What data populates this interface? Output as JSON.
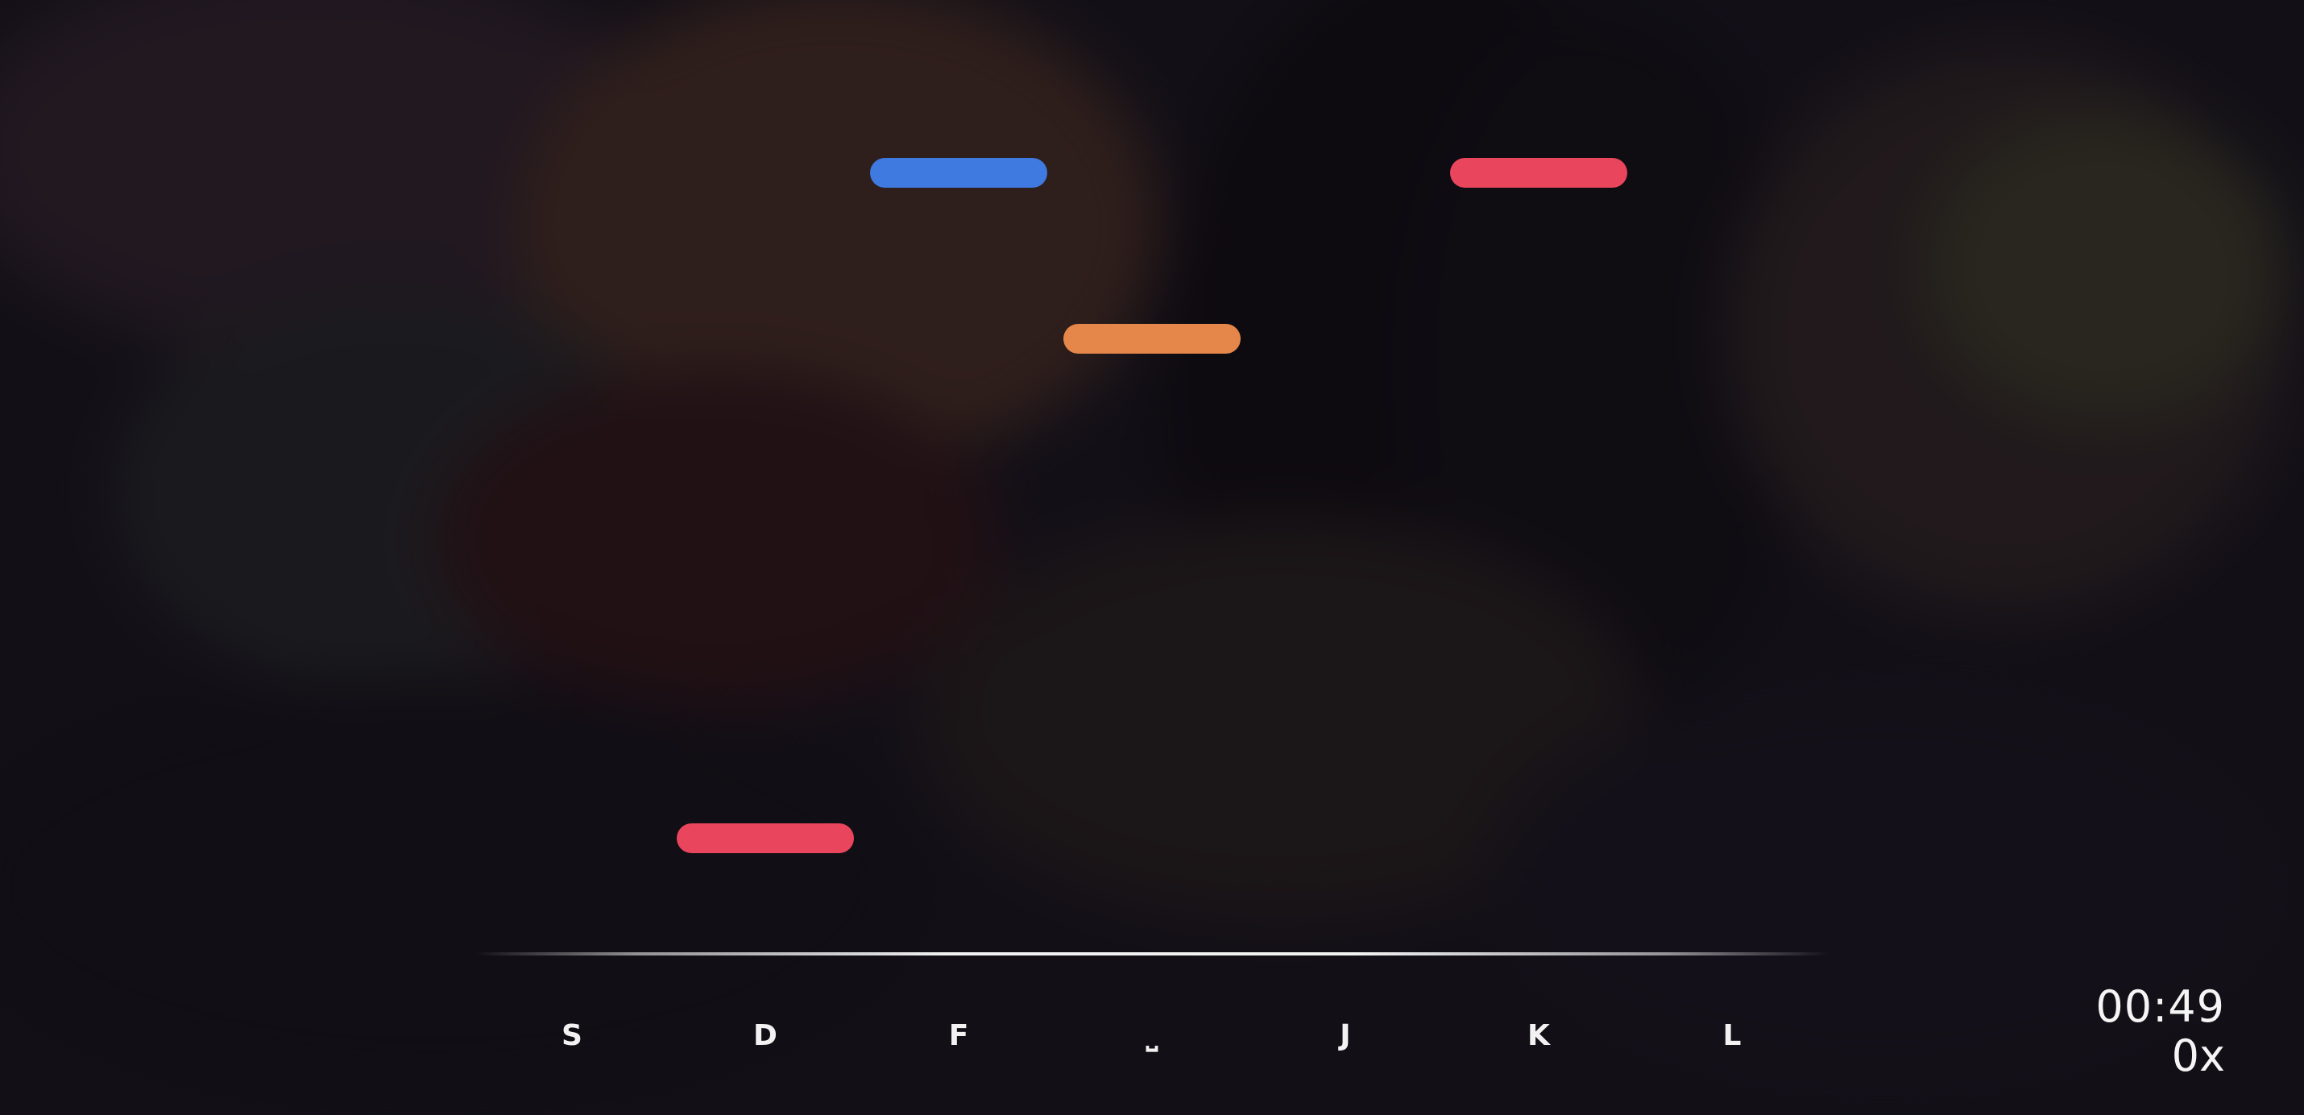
{
  "lanes": [
    {
      "key": "S"
    },
    {
      "key": "D"
    },
    {
      "key": "F"
    },
    {
      "key": "⎵"
    },
    {
      "key": "J"
    },
    {
      "key": "K"
    },
    {
      "key": "L"
    }
  ],
  "notes": [
    {
      "lane": 2,
      "color": "#3f7ae0"
    },
    {
      "lane": 5,
      "color": "#e9455c"
    },
    {
      "lane": 3,
      "color": "#e5864a"
    },
    {
      "lane": 1,
      "color": "#e9455c"
    }
  ],
  "hud": {
    "timer": "00:49",
    "combo": "0x"
  },
  "colors": {
    "note_blue": "#3f7ae0",
    "note_red": "#e9455c",
    "note_orange": "#e5864a",
    "hit_line": "#ffffff",
    "text": "#f2f2f2"
  }
}
